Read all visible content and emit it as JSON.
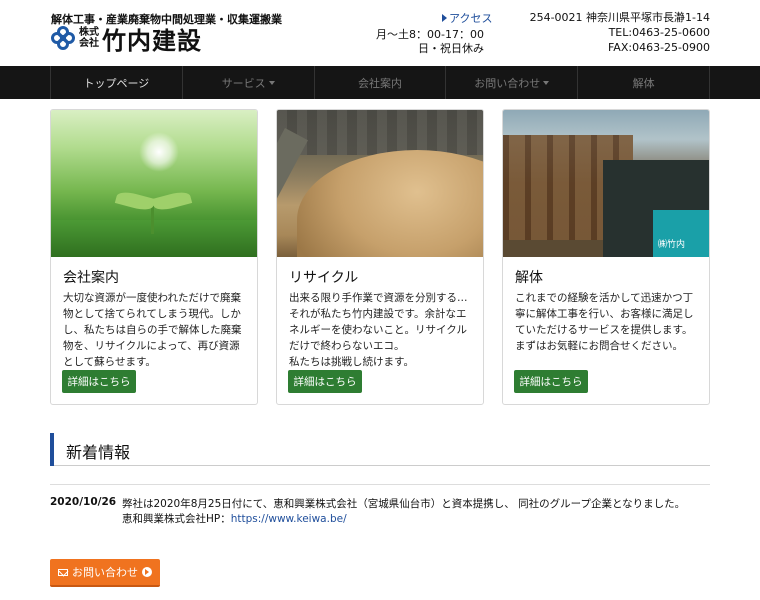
{
  "header": {
    "tagline": "解体工事・産業廃棄物中間処理業・収集運搬業",
    "logo": {
      "small_top": "株式",
      "small_bottom": "会社",
      "name": "竹内建設"
    },
    "access": "アクセス",
    "hours": [
      "月〜土8：00-17：00",
      "日・祝日休み"
    ],
    "address": "254-0021 神奈川県平塚市長瀞1-14",
    "tel": "TEL:0463-25-0600",
    "fax": "FAX:0463-25-0900"
  },
  "nav": {
    "items": [
      {
        "label": "トップページ",
        "dropdown": false
      },
      {
        "label": "サービス",
        "dropdown": true
      },
      {
        "label": "会社案内",
        "dropdown": false
      },
      {
        "label": "お問い合わせ",
        "dropdown": true
      },
      {
        "label": "解体",
        "dropdown": false
      }
    ]
  },
  "cards": [
    {
      "title": "会社案内",
      "text": "大切な資源が一度使われただけで廃棄物として捨てられてしまう現代。しかし、私たちは自らの手で解体した廃棄物を、リサイクルによって、再び資源として蘇らせます。",
      "button": "詳細はこちら"
    },
    {
      "title": "リサイクル",
      "text": "出来る限り手作業で資源を分別する…それが私たち竹内建設です。余計なエネルギーを使わないこと。リサイクルだけで終わらないエコ。",
      "text2": "私たちは挑戦し続けます。",
      "button": "詳細はこちら"
    },
    {
      "title": "解体",
      "text": "これまでの経験を活かして迅速かつ丁寧に解体工事を行い、お客様に満足していただけるサービスを提供します。まずはお気軽にお問合せください。",
      "button": "詳細はこちら",
      "image_label": "㈱竹内"
    }
  ],
  "news": {
    "title": "新着情報",
    "items": [
      {
        "date": "2020/10/26",
        "line1": "弊社は2020年8月25日付にて、恵和興業株式会社（宮城県仙台市）と資本提携し、 同社のグループ企業となりました。",
        "line2_prefix": "恵和興業株式会社HP：",
        "link": "https://www.keiwa.be/"
      }
    ]
  },
  "contact_button": "お問い合わせ"
}
